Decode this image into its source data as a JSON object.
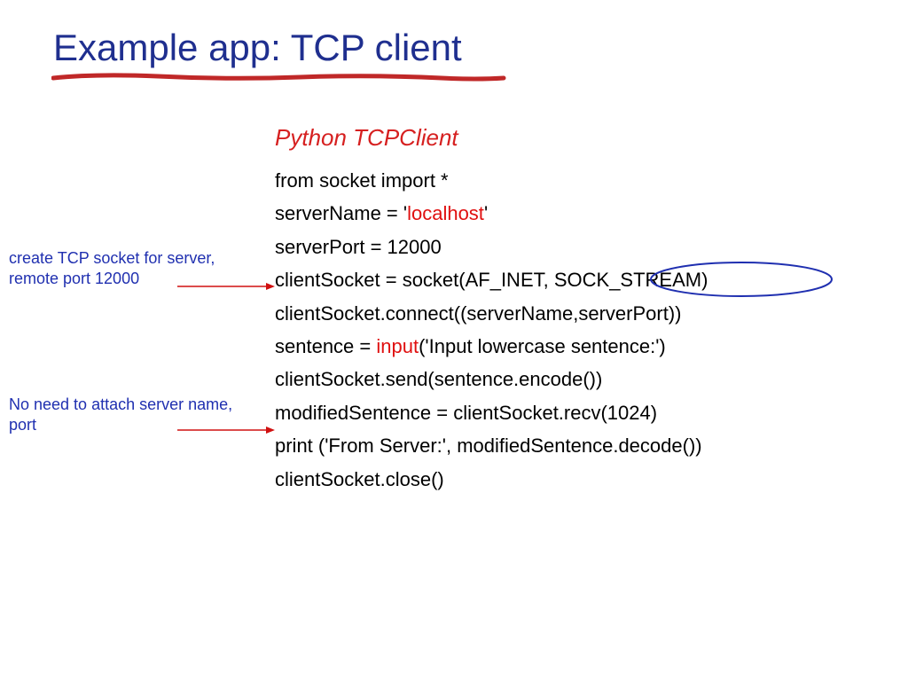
{
  "title": "Example app: TCP client",
  "subtitle": "Python TCPClient",
  "code": {
    "line1": "from socket import *",
    "line2_a": "serverName = '",
    "line2_b": "localhost",
    "line2_c": "'",
    "line3": "serverPort = 12000",
    "line4": "clientSocket = socket(AF_INET, SOCK_STREAM)",
    "line5": "clientSocket.connect((serverName,serverPort))",
    "line6_a": "sentence = ",
    "line6_b": "input",
    "line6_c": "('Input lowercase sentence:')",
    "line7": "clientSocket.send(sentence.encode())",
    "line8": "modifiedSentence = clientSocket.recv(1024)",
    "line9": "print ('From Server:', modifiedSentence.decode())",
    "line10": "clientSocket.close()"
  },
  "annotations": {
    "ann1": "create TCP socket for server, remote port 12000",
    "ann2": "No need to attach server name, port"
  }
}
